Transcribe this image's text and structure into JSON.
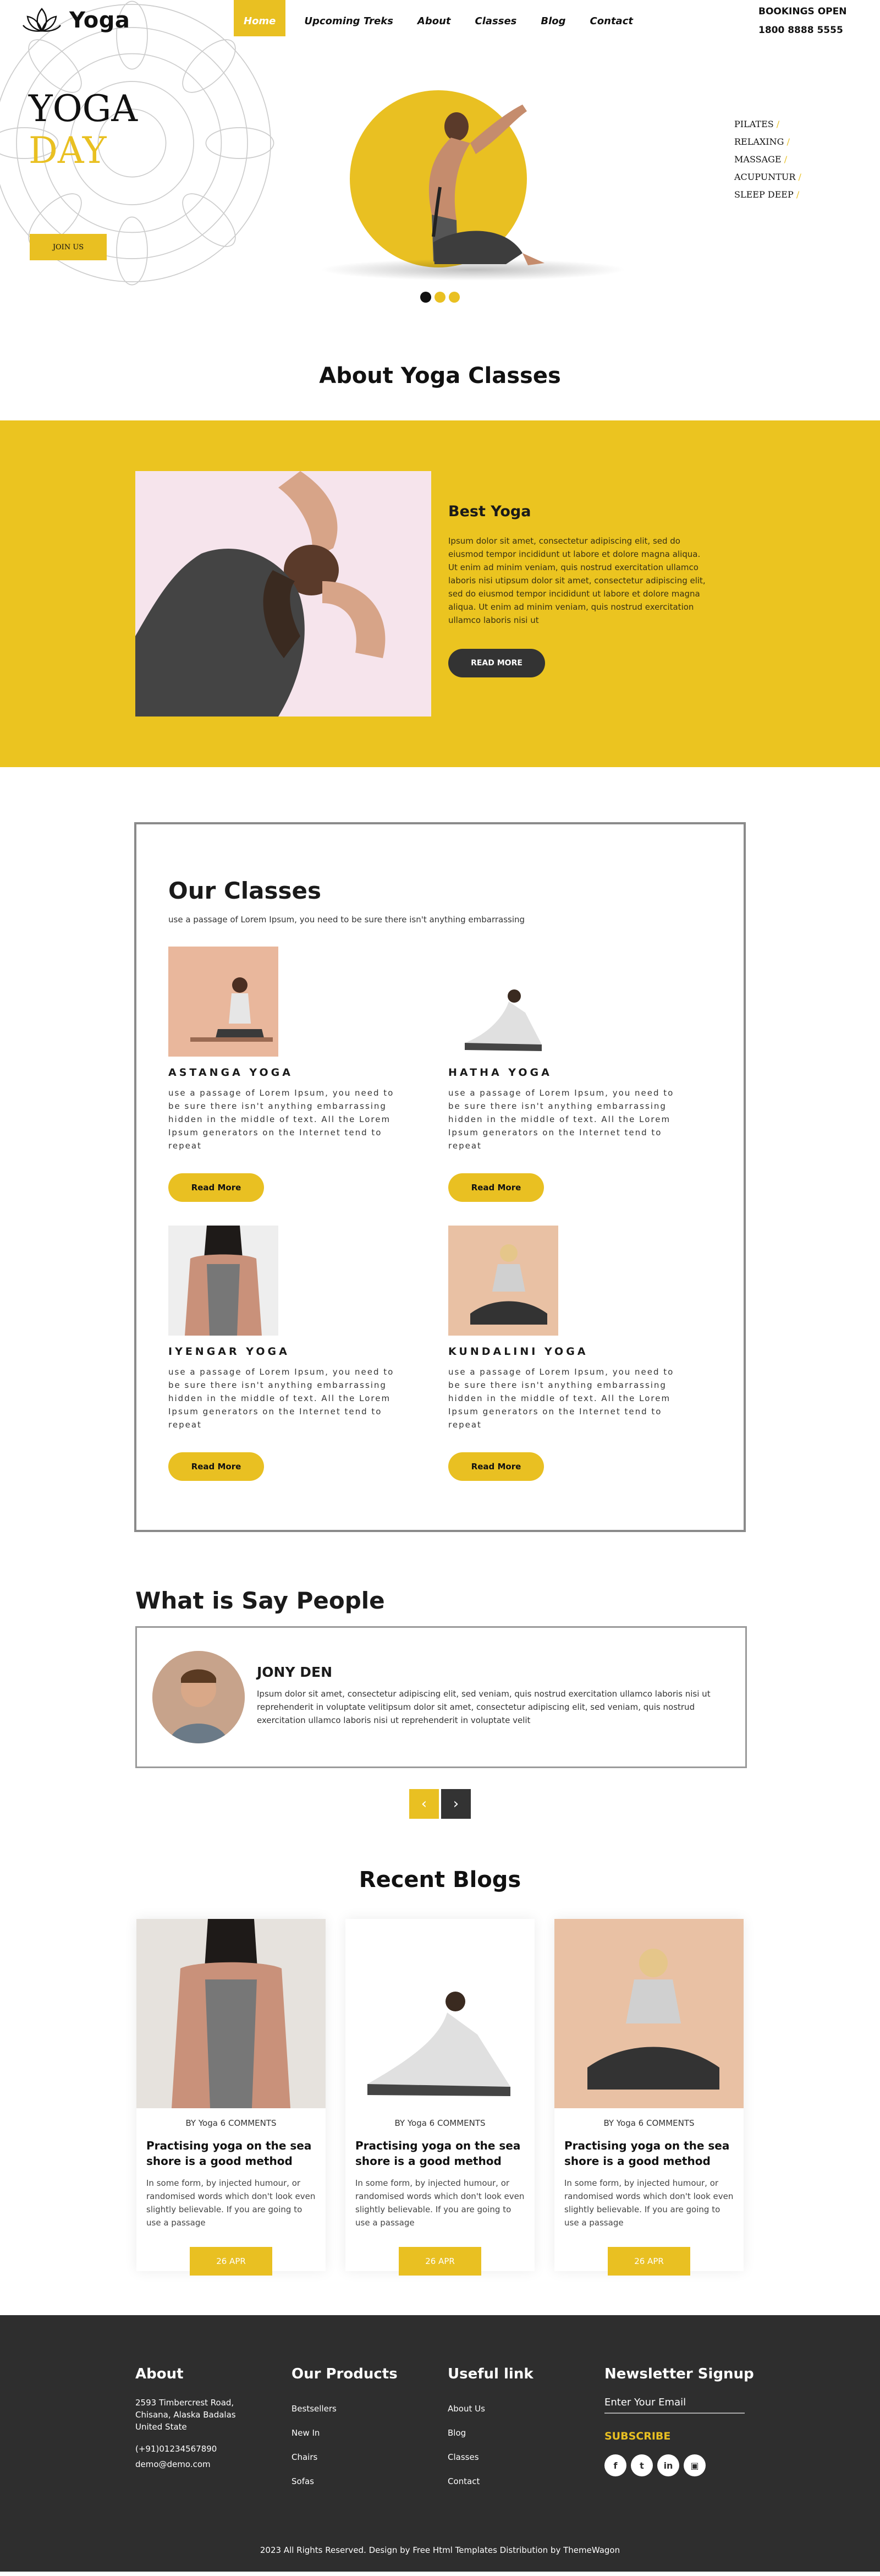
{
  "header": {
    "brand": "Yoga",
    "nav": [
      "Home",
      "Upcoming Treks",
      "About",
      "Classes",
      "Blog",
      "Contact"
    ],
    "booking_line1": "BOOKINGS OPEN",
    "booking_line2": "1800 8888 5555"
  },
  "hero": {
    "title_line1": "YOGA",
    "title_line2": "DAY",
    "join_label": "JOIN US",
    "side_list": [
      "PILATES",
      "RELAXING",
      "MASSAGE",
      "ACUPUNTUR",
      "SLEEP DEEP"
    ],
    "slide_count": 3,
    "active_slide": 1
  },
  "about": {
    "section_title": "About Yoga Classes",
    "heading": "Best Yoga",
    "text": "Ipsum dolor sit amet, consectetur adipiscing elit, sed do eiusmod tempor incididunt ut labore et dolore magna aliqua. Ut enim ad minim veniam, quis nostrud exercitation ullamco laboris nisi utipsum dolor sit amet, consectetur adipiscing elit, sed do eiusmod tempor incididunt ut labore et dolore magna aliqua. Ut enim ad minim veniam, quis nostrud exercitation ullamco laboris nisi ut",
    "button": "READ MORE"
  },
  "classes": {
    "title": "Our Classes",
    "subtitle": "use a passage of Lorem Ipsum, you need to be sure there isn't anything embarrassing",
    "items": [
      {
        "name": "ASTANGA YOGA",
        "desc": "use a passage of Lorem Ipsum, you need to be sure there isn't anything embarrassing hidden in the middle of text. All the Lorem Ipsum generators on the Internet tend to repeat",
        "button": "Read More"
      },
      {
        "name": "HATHA YOGA",
        "desc": "use a passage of Lorem Ipsum, you need to be sure there isn't anything embarrassing hidden in the middle of text. All the Lorem Ipsum generators on the Internet tend to repeat",
        "button": "Read More"
      },
      {
        "name": "IYENGAR YOGA",
        "desc": "use a passage of Lorem Ipsum, you need to be sure there isn't anything embarrassing hidden in the middle of text. All the Lorem Ipsum generators on the Internet tend to repeat",
        "button": "Read More"
      },
      {
        "name": "KUNDALINI YOGA",
        "desc": "use a passage of Lorem Ipsum, you need to be sure there isn't anything embarrassing hidden in the middle of text. All the Lorem Ipsum generators on the Internet tend to repeat",
        "button": "Read More"
      }
    ]
  },
  "testimonial": {
    "title": "What is Say People",
    "name": "JONY DEN",
    "text": "Ipsum dolor sit amet, consectetur adipiscing elit, sed veniam, quis nostrud exercitation ullamco laboris nisi ut reprehenderit in voluptate velitipsum dolor sit amet, consectetur adipiscing elit, sed veniam, quis nostrud exercitation ullamco laboris nisi ut reprehenderit in voluptate velit"
  },
  "blogs": {
    "title": "Recent Blogs",
    "items": [
      {
        "meta": "BY Yoga 6 COMMENTS",
        "title": "Practising yoga on the sea shore is a good method",
        "text": "In some form, by injected humour, or randomised words which don't look even slightly believable. If you are going to use a passage",
        "date": "26 APR"
      },
      {
        "meta": "BY Yoga 6 COMMENTS",
        "title": "Practising yoga on the sea shore is a good method",
        "text": "In some form, by injected humour, or randomised words which don't look even slightly believable. If you are going to use a passage",
        "date": "26 APR"
      },
      {
        "meta": "BY Yoga 6 COMMENTS",
        "title": "Practising yoga on the sea shore is a good method",
        "text": "In some form, by injected humour, or randomised words which don't look even slightly believable. If you are going to use a passage",
        "date": "26 APR"
      }
    ]
  },
  "footer": {
    "about_title": "About",
    "address": [
      "2593 Timbercrest Road,",
      "Chisana, Alaska Badalas",
      "United State"
    ],
    "phone": "(+91)01234567890",
    "email": "demo@demo.com",
    "products_title": "Our Products",
    "products": [
      "Bestsellers",
      "New In",
      "Chairs",
      "Sofas"
    ],
    "links_title": "Useful link",
    "links": [
      "About Us",
      "Blog",
      "Classes",
      "Contact"
    ],
    "newsletter_title": "Newsletter Signup",
    "email_placeholder": "Enter Your Email",
    "subscribe": "SUBSCRIBE",
    "socials": [
      "facebook-icon",
      "twitter-icon",
      "linkedin-icon",
      "instagram-icon"
    ],
    "copyright": "2023 All Rights Reserved. Design by Free Html Templates Distribution by ThemeWagon"
  },
  "colors": {
    "accent": "#e9c022",
    "dark": "#2e2e2e"
  }
}
